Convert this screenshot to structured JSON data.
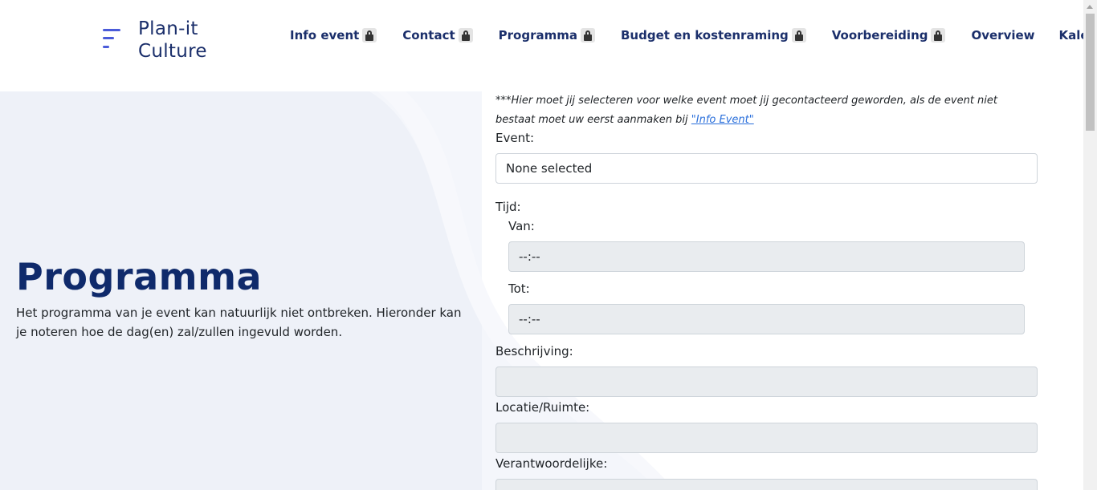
{
  "brand": {
    "line1": "Plan-it",
    "line2": "Culture"
  },
  "nav": {
    "items": [
      {
        "label": "Info event",
        "locked": true
      },
      {
        "label": "Contact",
        "locked": true
      },
      {
        "label": "Programma",
        "locked": true
      },
      {
        "label": "Budget en kostenraming",
        "locked": true
      },
      {
        "label": "Voorbereiding",
        "locked": true
      },
      {
        "label": "Overview",
        "locked": false
      },
      {
        "label": "Kalendar",
        "locked": false
      }
    ]
  },
  "hero": {
    "title": "Programma",
    "description": "Het programma van je event kan natuurlijk niet ontbreken. Hieronder kan je noteren hoe de dag(en) zal/zullen ingevuld worden."
  },
  "form": {
    "note_text": "***Hier moet jij selecteren voor welke event moet jij gecontacteerd geworden, als de event niet bestaat moet uw eerst aanmaken bij ",
    "note_link": "\"Info Event\"",
    "event_label": "Event:",
    "event_value": "None selected",
    "tijd_label": "Tijd:",
    "van_label": "Van:",
    "van_value": "--:--",
    "tot_label": "Tot:",
    "tot_value": "--:--",
    "beschrijving_label": "Beschrijving:",
    "beschrijving_value": "",
    "locatie_label": "Locatie/Ruimte:",
    "locatie_value": "",
    "verantwoordelijke_label": "Verantwoordelijke:",
    "verantwoordelijke_value": ""
  },
  "colors": {
    "brand": "#1b2f6b",
    "accent": "#4a5bd9",
    "hero_bg": "#eef1f8",
    "link": "#2a6fdb"
  }
}
